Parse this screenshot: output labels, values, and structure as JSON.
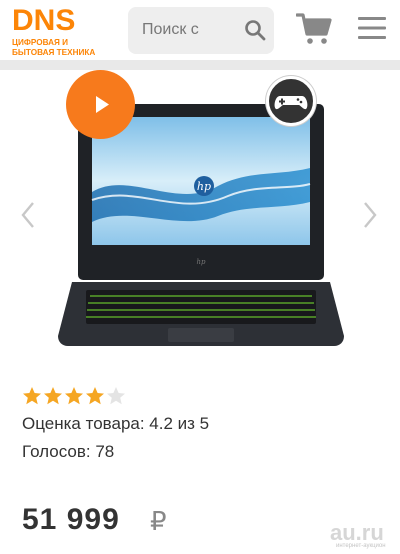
{
  "header": {
    "logo_main": "DNS",
    "logo_line1": "ЦИФРОВАЯ И",
    "logo_line2": "БЫТОВАЯ ТЕХНИКА",
    "search_placeholder": "Поиск с",
    "brand_color": "#fc8507"
  },
  "gallery": {
    "screen_logo": "hp",
    "play_icon": "play-icon",
    "gaming_icon": "gamepad-icon",
    "prev_icon": "chevron-left-icon",
    "next_icon": "chevron-right-icon"
  },
  "product": {
    "rating_stars": 4,
    "rating_max": 5,
    "rating_text": "Оценка товара: 4.2 из 5",
    "votes_text": "Голосов: 78",
    "price": "51 999",
    "currency": "₽"
  },
  "watermark": {
    "text": "au.ru",
    "sub": "интернет-аукцион"
  }
}
